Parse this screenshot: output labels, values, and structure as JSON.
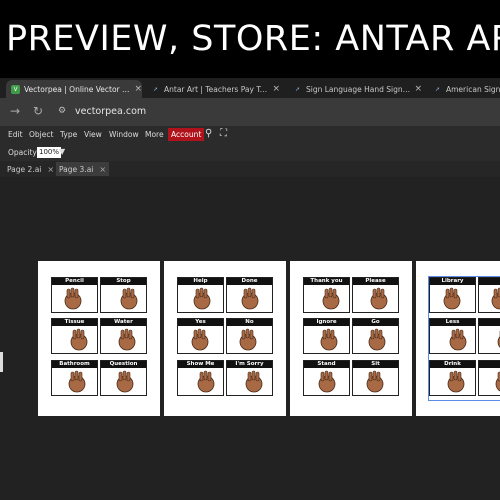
{
  "banner": {
    "text": "PREVIEW, STORE: ANTAR ART"
  },
  "browser": {
    "tabs": [
      {
        "title": "Vectorpea | Online Vector Edito",
        "active": true,
        "favicon": "vectorpea-icon"
      },
      {
        "title": "Antar Art | Teachers Pay Teache",
        "active": false,
        "favicon": "tpt-icon"
      },
      {
        "title": "Sign Language Hand Signals Cl",
        "active": false,
        "favicon": "tpt-icon"
      },
      {
        "title": "American Sign La",
        "active": false,
        "favicon": "tpt-icon"
      }
    ],
    "url": "vectorpea.com"
  },
  "menu": {
    "items": [
      "Edit",
      "Object",
      "Type",
      "View",
      "Window",
      "More"
    ],
    "account_label": "Account"
  },
  "options": {
    "opacity_label": "Opacity:",
    "opacity_value": "100%"
  },
  "doc_tabs": [
    {
      "label": "Page 2.ai",
      "active": false
    },
    {
      "label": "Page 3.ai",
      "active": true
    }
  ],
  "pages": [
    {
      "cards": [
        "Pencil",
        "Stop",
        "Tissue",
        "Water",
        "Bathroom",
        "Question"
      ]
    },
    {
      "cards": [
        "Help",
        "Done",
        "Yes",
        "No",
        "Show Me",
        "I'm Sorry"
      ]
    },
    {
      "cards": [
        "Thank you",
        "Please",
        "Ignore",
        "Go",
        "Stand",
        "Sit"
      ]
    },
    {
      "cards": [
        "Library",
        "",
        "Less",
        "",
        "Drink",
        ""
      ]
    }
  ],
  "colors": {
    "accent": "#b0131c",
    "skin": "#a86a45",
    "selection": "#5b8de6"
  }
}
